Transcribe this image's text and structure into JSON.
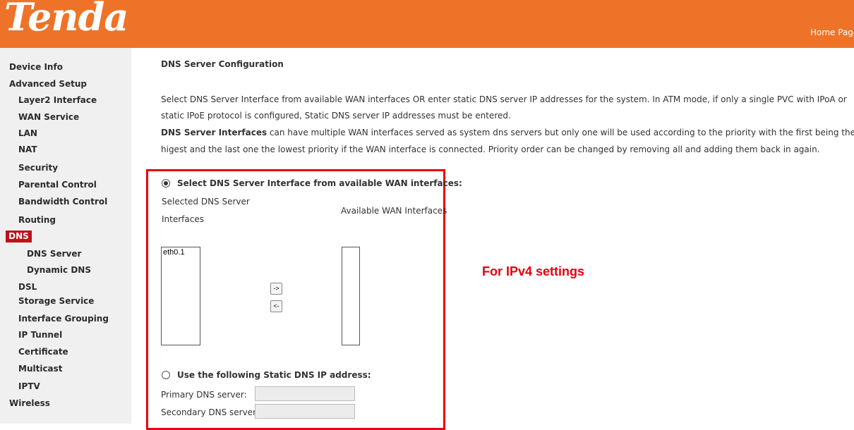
{
  "header": {
    "logo": "Tenda",
    "home_link": "Home Page"
  },
  "sidebar": {
    "items": [
      {
        "label": "Device Info"
      },
      {
        "label": "Advanced Setup"
      },
      {
        "label": "Layer2 Interface"
      },
      {
        "label": "WAN Service"
      },
      {
        "label": "LAN"
      },
      {
        "label": "NAT"
      },
      {
        "label": "Security"
      },
      {
        "label": "Parental Control"
      },
      {
        "label": "Bandwidth Control"
      },
      {
        "label": "Routing"
      },
      {
        "label": "DNS"
      },
      {
        "label": "DNS Server"
      },
      {
        "label": "Dynamic DNS"
      },
      {
        "label": "DSL"
      },
      {
        "label": "Storage Service"
      },
      {
        "label": "Interface Grouping"
      },
      {
        "label": "IP Tunnel"
      },
      {
        "label": "Certificate"
      },
      {
        "label": "Multicast"
      },
      {
        "label": "IPTV"
      },
      {
        "label": "Wireless"
      }
    ],
    "active_color": "#c0101c"
  },
  "main": {
    "title": "DNS Server Configuration",
    "desc_line1": "Select DNS Server Interface from available WAN interfaces OR enter static DNS server IP addresses for the system. In ATM mode, if only a single PVC with IPoA or",
    "desc_line2": "static IPoE protocol is configured, Static DNS server IP addresses must be entered.",
    "desc_line3_bold": "DNS Server Interfaces",
    "desc_line3_rest": " can have multiple WAN interfaces served as system dns servers but only one will be used according to the priority with the first being the",
    "desc_line4": "higest and the last one the lowest priority if the WAN interface is connected. Priority order can be changed by removing all and adding them back in again.",
    "option_interface_label": "Select DNS Server Interface from available WAN interfaces:",
    "option_interface_selected": true,
    "selected_label_line1": "Selected DNS Server",
    "selected_label_line2": "Interfaces",
    "available_label": "Available WAN Interfaces",
    "selected_interfaces": [
      "eth0.1"
    ],
    "available_interfaces": [],
    "add_button": "->",
    "remove_button": "<-",
    "option_static_label": "Use the following Static DNS IP address:",
    "option_static_selected": false,
    "primary_label": "Primary DNS server:",
    "primary_value": "",
    "secondary_label": "Secondary DNS server:",
    "secondary_value": ""
  },
  "annotation": {
    "text": "For IPv4 settings",
    "color": "#e8000f"
  },
  "colors": {
    "header_bg": "#ee7328",
    "sidebar_bg": "#f0f0f0"
  }
}
